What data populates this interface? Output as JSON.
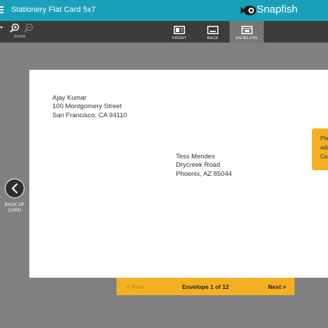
{
  "header": {
    "project_title": "Stationery Flat Card 5x7",
    "brand": "Snapfish"
  },
  "toolbar": {
    "zoom_label": "ZOOM",
    "tabs": [
      {
        "label": "FRONT",
        "active": false
      },
      {
        "label": "BACK",
        "active": false
      },
      {
        "label": "ENVELOPE",
        "active": true
      }
    ]
  },
  "envelope": {
    "return_address": [
      "Ajay Kumar",
      "100 Montgomery Street",
      "San Francisco, CA 94110"
    ],
    "recipient_address": [
      "Tess Mendes",
      "Drycreek Road",
      "Phoenix, AZ 85044"
    ]
  },
  "tooltip": {
    "lines": [
      "Ple",
      "add",
      "Ca"
    ]
  },
  "navigation": {
    "back_label_line1": "BACK OF",
    "back_label_line2": "CARD"
  },
  "pager": {
    "prev_label": "< Prev",
    "status": "Envelope 1 of 12",
    "next_label": "Next >"
  },
  "colors": {
    "header_teal": "#1ba0bb",
    "toolbar_dark": "#3c3c3c",
    "canvas_gray": "#808080",
    "accent_yellow": "#f2b022"
  }
}
